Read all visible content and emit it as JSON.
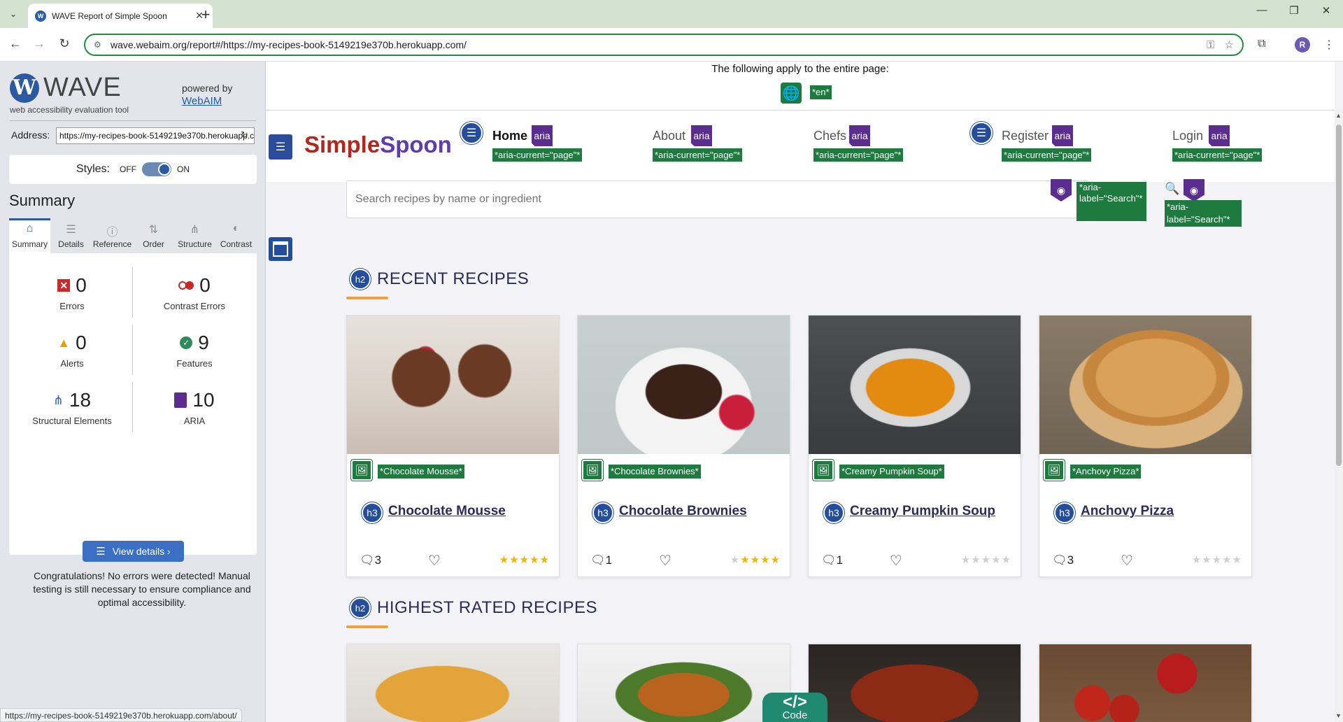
{
  "browser": {
    "tab_title": "WAVE Report of Simple Spoon",
    "favicon_letter": "W",
    "url": "wave.webaim.org/report#/https://my-recipes-book-5149219e370b.herokuapp.com/",
    "profile_initial": "R",
    "status_url": "https://my-recipes-book-5149219e370b.herokuapp.com/about/"
  },
  "wave": {
    "logo_text": "WAVE",
    "logo_mark": "W",
    "tagline": "web accessibility evaluation tool",
    "powered_by": "powered by",
    "webaim_link": "WebAIM",
    "address_label": "Address:",
    "address_value": "https://my-recipes-book-5149219e370b.herokuapp.com/",
    "styles_label": "Styles:",
    "styles_off": "OFF",
    "styles_on": "ON",
    "styles_state": "on",
    "summary_title": "Summary",
    "tabs": [
      {
        "label": "Summary",
        "icon": "home-icon",
        "active": true
      },
      {
        "label": "Details",
        "icon": "list-icon"
      },
      {
        "label": "Reference",
        "icon": "info-icon"
      },
      {
        "label": "Order",
        "icon": "order-icon"
      },
      {
        "label": "Structure",
        "icon": "structure-icon"
      },
      {
        "label": "Contrast",
        "icon": "contrast-icon"
      }
    ],
    "stats": {
      "errors": {
        "value": "0",
        "label": "Errors"
      },
      "contrast_errors": {
        "value": "0",
        "label": "Contrast Errors"
      },
      "alerts": {
        "value": "0",
        "label": "Alerts"
      },
      "features": {
        "value": "9",
        "label": "Features"
      },
      "structural": {
        "value": "18",
        "label": "Structural Elements"
      },
      "aria": {
        "value": "10",
        "label": "ARIA"
      }
    },
    "view_details": "View details ›",
    "congrats": "Congratulations! No errors were detected! Manual testing is still necessary to ensure compliance and optimal accessibility."
  },
  "page": {
    "applies_text": "The following apply to the entire page:",
    "lang_tag": "*en*",
    "logo_simple": "Simple",
    "logo_spoon": "Spoon",
    "aria_chip": "aria",
    "nav": [
      {
        "label": "Home",
        "active": true,
        "tag": "*aria-current=\"page\"*"
      },
      {
        "label": "About",
        "tag": "*aria-current=\"page\"*"
      },
      {
        "label": "Chefs",
        "tag": "*aria-current=\"page\"*"
      },
      {
        "label": "Register",
        "tag": "*aria-current=\"page\"*"
      },
      {
        "label": "Login",
        "tag": "*aria-current=\"page\"*"
      }
    ],
    "search_placeholder": "Search recipes by name or ingredient",
    "search_button_tag": "*aria-label=\"Search\"*",
    "search_icon_tag": "*aria-label=\"Search\"*",
    "h2_badge": "h2",
    "h3_badge": "h3",
    "recent_title": "RECENT RECIPES",
    "highest_title": "HIGHEST RATED RECIPES",
    "recent": [
      {
        "title": "Chocolate Mousse",
        "alt": "*Chocolate Mousse*",
        "comments": "3",
        "rating": 5
      },
      {
        "title": "Chocolate Brownies",
        "alt": "*Chocolate Brownies*",
        "comments": "1",
        "rating": 4
      },
      {
        "title": "Creamy Pumpkin Soup",
        "alt": "*Creamy Pumpkin Soup*",
        "comments": "1",
        "rating": 0
      },
      {
        "title": "Anchovy Pizza",
        "alt": "*Anchovy Pizza*",
        "comments": "3",
        "rating": 0
      }
    ],
    "code_icon": "</>",
    "code_label": "Code"
  },
  "colors": {
    "wave_blue": "#2b5aa3",
    "wave_green": "#1f7a3f",
    "aria_purple": "#5b2d8e",
    "brand_red": "#b3261e",
    "brand_purple": "#5e3bb1",
    "accent_orange": "#f0a23a",
    "star_gold": "#f5b301"
  }
}
